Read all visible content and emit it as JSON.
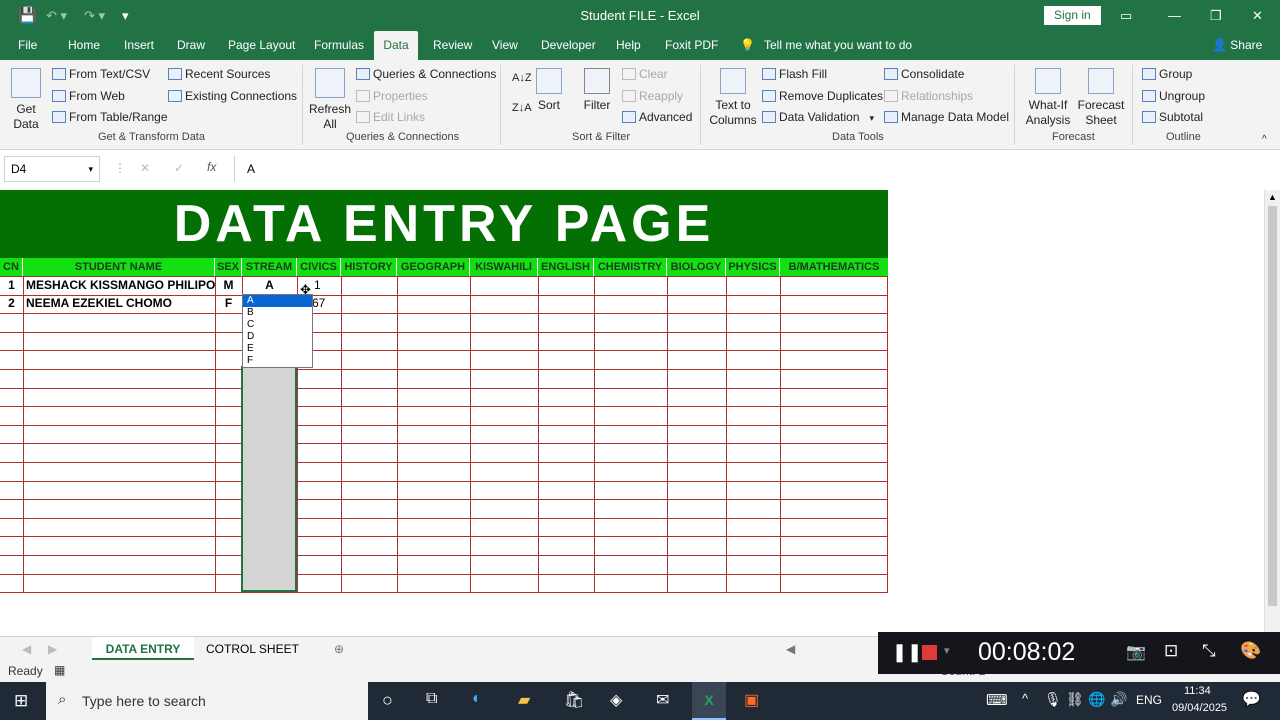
{
  "window": {
    "title": "Student FILE  -  Excel",
    "sign_in": "Sign in"
  },
  "ribbon_tabs": [
    "File",
    "Home",
    "Insert",
    "Draw",
    "Page Layout",
    "Formulas",
    "Data",
    "Review",
    "View",
    "Developer",
    "Help",
    "Foxit PDF"
  ],
  "tell_me": "Tell me what you want to do",
  "share": "Share",
  "ribbon": {
    "get_data": "Get\nData",
    "from_text_csv": "From Text/CSV",
    "from_web": "From Web",
    "from_table": "From Table/Range",
    "recent_sources": "Recent Sources",
    "existing_connections": "Existing Connections",
    "group_get_transform": "Get & Transform Data",
    "refresh_all": "Refresh\nAll",
    "queries_connections": "Queries & Connections",
    "properties": "Properties",
    "edit_links": "Edit Links",
    "group_queries": "Queries & Connections",
    "sort": "Sort",
    "filter": "Filter",
    "clear": "Clear",
    "reapply": "Reapply",
    "advanced": "Advanced",
    "group_sort_filter": "Sort & Filter",
    "text_to_columns": "Text to\nColumns",
    "flash_fill": "Flash Fill",
    "remove_duplicates": "Remove Duplicates",
    "data_validation": "Data Validation",
    "consolidate": "Consolidate",
    "relationships": "Relationships",
    "manage_data_model": "Manage Data Model",
    "group_data_tools": "Data Tools",
    "what_if": "What-If\nAnalysis",
    "forecast_sheet": "Forecast\nSheet",
    "group_forecast": "Forecast",
    "group_btn": "Group",
    "ungroup": "Ungroup",
    "subtotal": "Subtotal",
    "group_outline": "Outline"
  },
  "formula_bar": {
    "name_box": "D4",
    "fx": "fx",
    "value": "A"
  },
  "sheet": {
    "banner": "DATA ENTRY PAGE",
    "headers": [
      "CN",
      "STUDENT NAME",
      "SEX",
      "STREAM",
      "CIVICS",
      "HISTORY",
      "GEOGRAPH",
      "KISWAHILI",
      "ENGLISH",
      "CHEMISTRY",
      "BIOLOGY",
      "PHYSICS",
      "B/MATHEMATICS"
    ],
    "rows": [
      {
        "cn": "1",
        "name": "MESHACK KISSMANGO PHILIPO",
        "sex": "M",
        "stream": "A",
        "civics": "1"
      },
      {
        "cn": "2",
        "name": "NEEMA EZEKIEL CHOMO",
        "sex": "F",
        "stream": "",
        "civics": "67"
      }
    ],
    "dropdown_options": [
      "A",
      "B",
      "C",
      "D",
      "E",
      "F"
    ]
  },
  "sheet_tabs": [
    "DATA ENTRY",
    "COTROL SHEET"
  ],
  "status": {
    "ready": "Ready",
    "count": "Count: 2"
  },
  "recorder": {
    "time": "00:08:02"
  },
  "taskbar": {
    "search": "Type here to search",
    "lang": "ENG",
    "time": "11:34",
    "date": "09/04/2025"
  },
  "colors": {
    "excel_green": "#217346",
    "banner_green": "#047004",
    "header_green": "#12e012",
    "grid_red": "#b03030"
  }
}
